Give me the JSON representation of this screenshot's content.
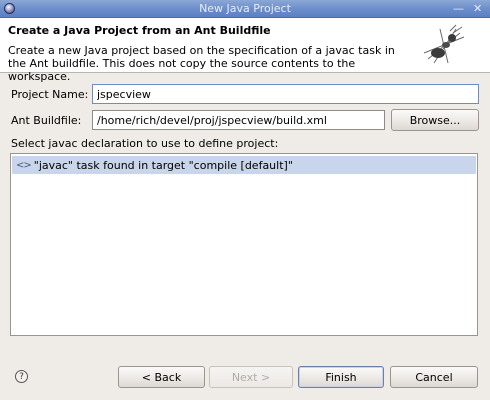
{
  "window": {
    "title": "New Java Project",
    "minimize_glyph": "—",
    "close_glyph": "✕"
  },
  "header": {
    "title": "Create a Java Project from an Ant Buildfile",
    "description": "Create a new Java project based on the specification of a javac task in the Ant buildfile. This does not copy the source contents to the workspace.",
    "icon": "ant-icon"
  },
  "form": {
    "project_name_label": "Project Name:",
    "project_name_value": "jspecview",
    "ant_buildfile_label": "Ant Buildfile:",
    "ant_buildfile_value": "/home/rich/devel/proj/jspecview/build.xml",
    "browse_label": "Browse...",
    "select_label": "Select javac declaration to use to define project:"
  },
  "javac_list": {
    "items": [
      {
        "icon": "javac-task-icon",
        "label": "\"javac\" task found in target \"compile [default]\"",
        "selected": true
      }
    ]
  },
  "footer": {
    "help_icon": "help-icon",
    "back_label": "< Back",
    "next_label": "Next >",
    "finish_label": "Finish",
    "cancel_label": "Cancel"
  }
}
